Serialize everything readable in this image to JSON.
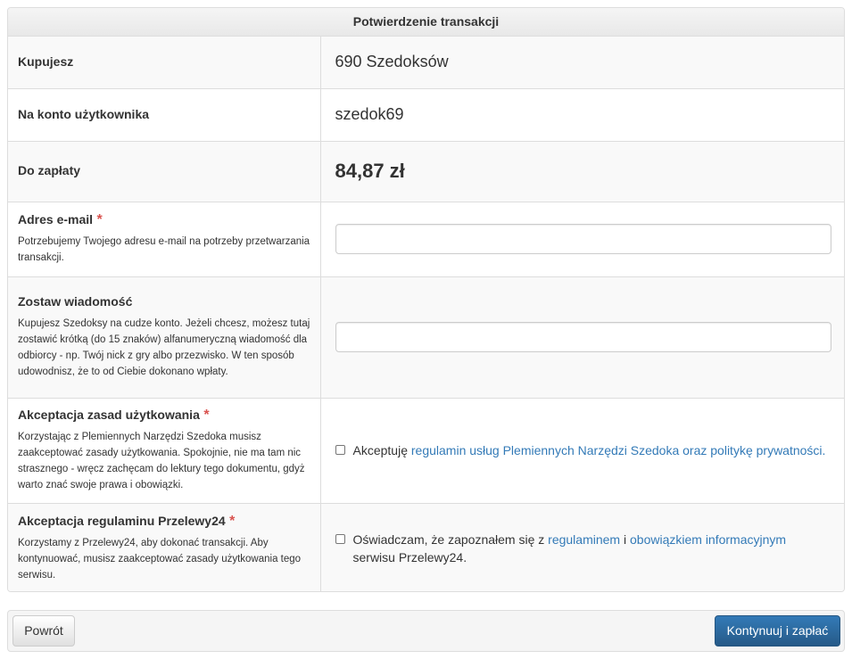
{
  "panel": {
    "title": "Potwierdzenie transakcji"
  },
  "rows": {
    "buy": {
      "label": "Kupujesz",
      "value": "690 Szedoksów"
    },
    "account": {
      "label": "Na konto użytkownika",
      "value": "szedok69"
    },
    "pay": {
      "label": "Do zapłaty",
      "value": "84,87 zł"
    },
    "email": {
      "label": "Adres e-mail",
      "required_mark": "*",
      "help": "Potrzebujemy Twojego adresu e-mail na potrzeby przetwarzania transakcji.",
      "value": ""
    },
    "message": {
      "label": "Zostaw wiadomość",
      "help": "Kupujesz Szedoksy na cudze konto. Jeżeli chcesz, możesz tutaj zostawić krótką (do 15 znaków) alfanumeryczną wiadomość dla odbiorcy - np. Twój nick z gry albo przezwisko. W ten sposób udowodnisz, że to od Ciebie dokonano wpłaty.",
      "value": ""
    },
    "terms": {
      "label": "Akceptacja zasad użytkowania",
      "required_mark": "*",
      "help": "Korzystając z Plemiennych Narzędzi Szedoka musisz zaakceptować zasady użytkowania. Spokojnie, nie ma tam nic strasznego - wręcz zachęcam do lektury tego dokumentu, gdyż warto znać swoje prawa i obowiązki.",
      "check_prefix": "Akceptuję",
      "check_link": "regulamin usług Plemiennych Narzędzi Szedoka oraz politykę prywatności.",
      "checked": false
    },
    "p24": {
      "label": "Akceptacja regulaminu Przelewy24",
      "required_mark": "*",
      "help": "Korzystamy z Przelewy24, aby dokonać transakcji. Aby kontynuować, musisz zaakceptować zasady użytkowania tego serwisu.",
      "check_prefix": "Oświadczam, że zapoznałem się z",
      "check_link1": "regulaminem",
      "check_mid": "i",
      "check_link2": "obowiązkiem informacyjnym",
      "check_suffix": "serwisu Przelewy24.",
      "checked": false
    }
  },
  "footer": {
    "back_label": "Powrót",
    "continue_label": "Kontynuuj i zapłać"
  },
  "colors": {
    "link": "#337ab7",
    "required": "#d9534f",
    "primary": "#2e6da4"
  }
}
